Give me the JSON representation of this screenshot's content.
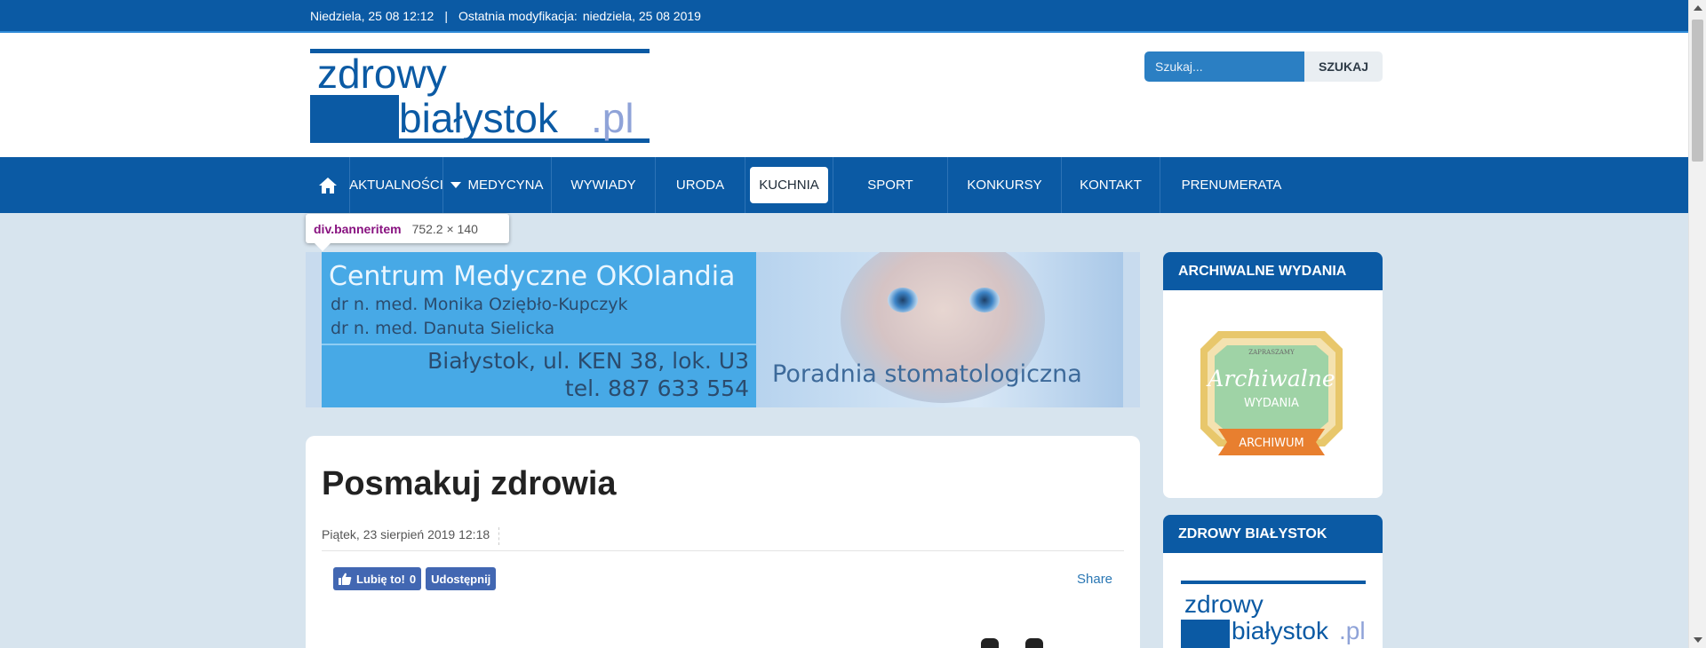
{
  "topbar": {
    "date": "Niedziela, 25 08 12:12",
    "separator": "|",
    "modified_label": "Ostatnia modyfikacja:",
    "modified_value": "niedziela, 25 08 2019"
  },
  "header": {
    "logo_line1": "zdrowy",
    "logo_line2": "białystok",
    "logo_suffix": ".pl",
    "search_placeholder": "Szukaj...",
    "search_button": "SZUKAJ"
  },
  "nav": {
    "home_icon": "home-icon",
    "items": [
      {
        "label": "AKTUALNOŚCI"
      },
      {
        "label": "MEDYCYNA"
      },
      {
        "label": "WYWIADY"
      },
      {
        "label": "URODA"
      },
      {
        "label": "KUCHNIA"
      },
      {
        "label": "SPORT"
      },
      {
        "label": "KONKURSY"
      },
      {
        "label": "KONTAKT"
      },
      {
        "label": "PRENUMERATA"
      }
    ]
  },
  "tooltip": {
    "tag": "div",
    "cls": ".banneritem",
    "dims": "752.2 × 140"
  },
  "banner": {
    "line1": "Centrum Medyczne OKOlandia",
    "line2": "dr n. med. Monika Oziębło-Kupczyk",
    "line3": "dr n. med. Danuta Sielicka",
    "line4": "Białystok, ul. KEN 38, lok. U3",
    "line5": "tel. 887 633 554",
    "tagline": "Poradnia stomatologiczna"
  },
  "article": {
    "title": "Posmakuj zdrowia",
    "date": "Piątek, 23 sierpień 2019 12:18",
    "like_label": "Lubię to!",
    "like_count": "0",
    "share_fb_label": "Udostępnij",
    "share_label": "Share"
  },
  "sidebar": {
    "archive_title": "ARCHIWALNE WYDANIA",
    "archive_badge_top": "ZAPRASZAMY",
    "archive_badge_main": "Archiwalne",
    "archive_badge_sub": "WYDANIA",
    "archive_ribbon": "ARCHIWUM",
    "zb_title": "ZDROWY BIAŁYSTOK",
    "zb_logo_line1": "zdrowy",
    "zb_logo_line2": "białystok",
    "zb_logo_suffix": ".pl"
  },
  "colors": {
    "brand_blue": "#0b5aa4",
    "background": "#d7e4ee",
    "logo_light": "#8fa3d8"
  }
}
